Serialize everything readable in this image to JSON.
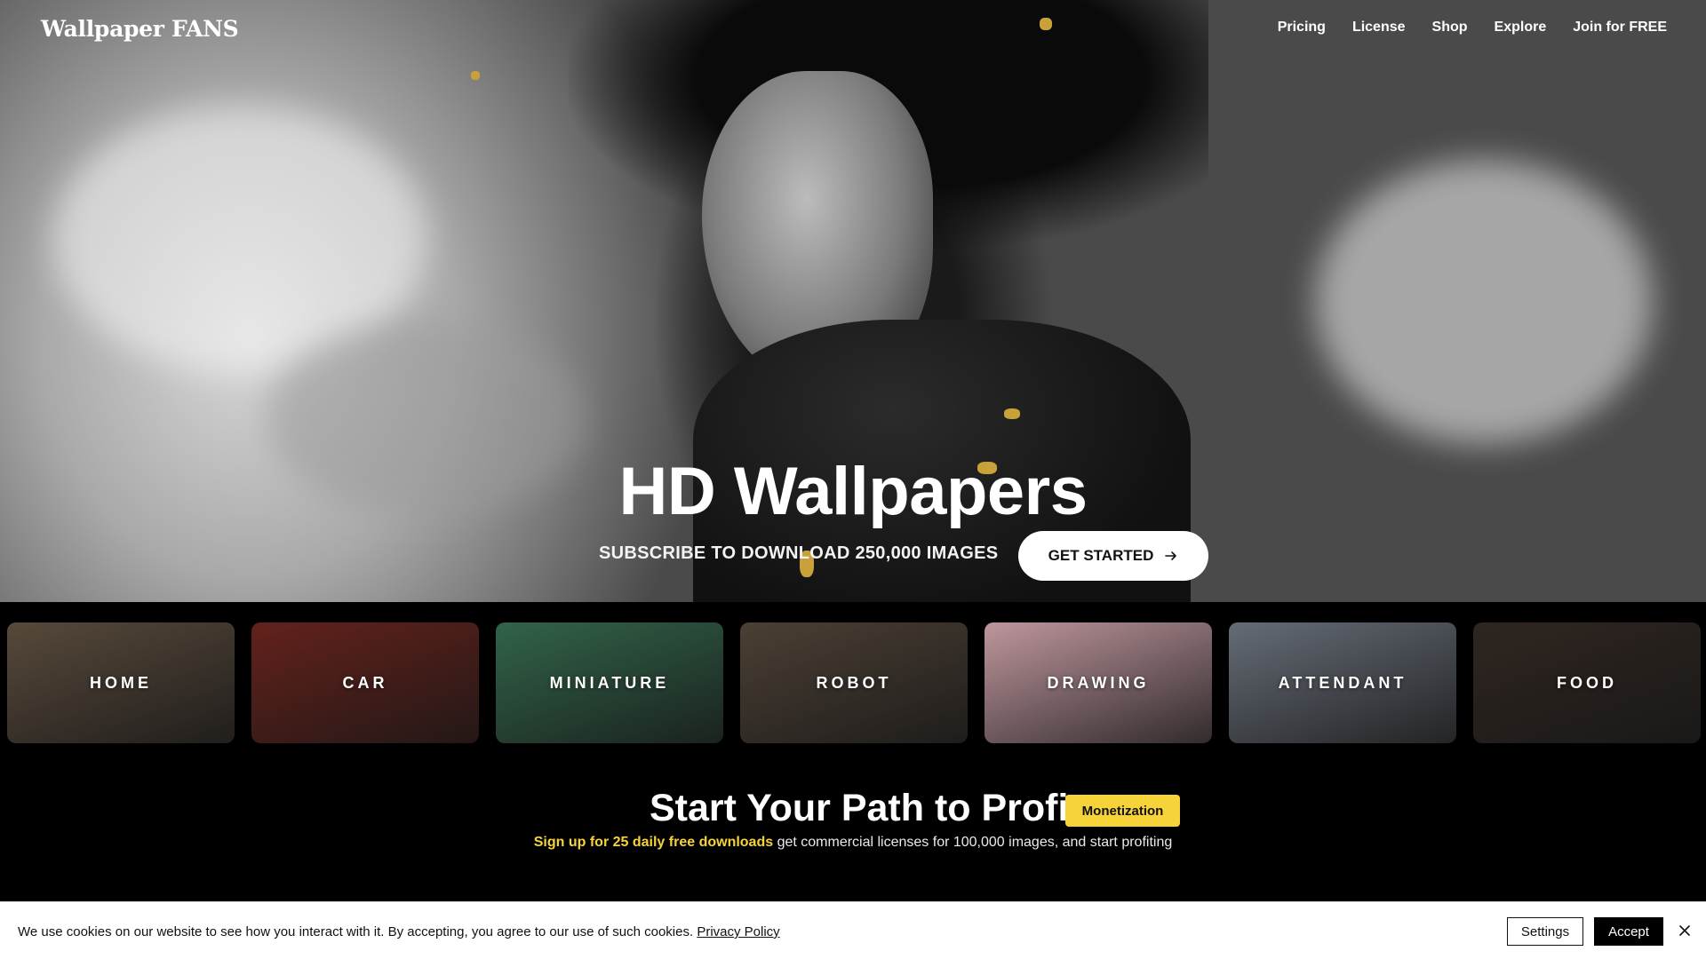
{
  "header": {
    "logo": "Wallpaper FANS",
    "nav": [
      "Pricing",
      "License",
      "Shop",
      "Explore",
      "Join for FREE"
    ]
  },
  "hero": {
    "title": "HD Wallpapers",
    "subtitle": "SUBSCRIBE TO DOWNLOAD 250,000 IMAGES",
    "cta_label": "GET STARTED",
    "cta_icon": "arrow-right-icon"
  },
  "categories": [
    {
      "label": "HOME",
      "color": "#6b5a48"
    },
    {
      "label": "CAR",
      "color": "#7a2a22"
    },
    {
      "label": "MINIATURE",
      "color": "#3d7a5a"
    },
    {
      "label": "ROBOT",
      "color": "#5c4e40"
    },
    {
      "label": "DRAWING",
      "color": "#e8b8c0"
    },
    {
      "label": "ATTENDANT",
      "color": "#7c8490"
    },
    {
      "label": "FOOD",
      "color": "#3a2f28"
    }
  ],
  "profit": {
    "title": "Start Your Path to Profit",
    "badge": "Monetization",
    "highlight": "Sign up for 25 daily free downloads",
    "rest": " get commercial licenses for 100,000 images, and start profiting"
  },
  "cookie": {
    "text": "We use cookies on our website to see how you interact with it. By accepting, you agree to our use of such cookies. ",
    "policy_link": "Privacy Policy",
    "settings_label": "Settings",
    "accept_label": "Accept",
    "close_icon": "close-icon"
  },
  "colors": {
    "accent_yellow": "#f6d338",
    "background": "#000000"
  }
}
